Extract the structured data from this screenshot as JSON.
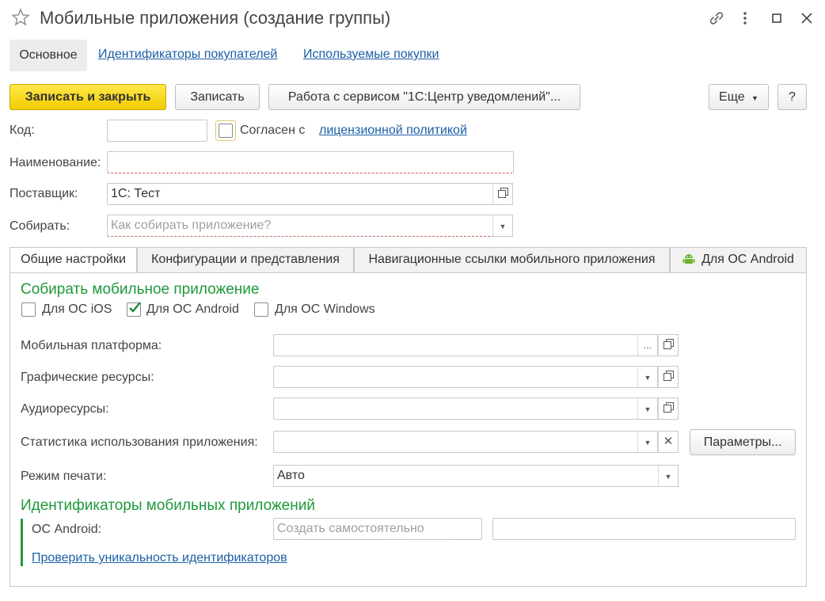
{
  "window": {
    "title": "Мобильные приложения (создание группы)"
  },
  "nav_tabs": [
    {
      "label": "Основное"
    },
    {
      "label": "Идентификаторы покупателей"
    },
    {
      "label": "Используемые покупки"
    }
  ],
  "toolbar": {
    "save_close": "Записать и закрыть",
    "save": "Записать",
    "service": "Работа с сервисом \"1С:Центр уведомлений\"...",
    "more": "Еще",
    "help": "?"
  },
  "form": {
    "code_label": "Код:",
    "code_value": "",
    "agree_text": "Согласен с",
    "license_link": "лицензионной политикой",
    "name_label": "Наименование:",
    "name_value": "",
    "supplier_label": "Поставщик:",
    "supplier_value": "1С: Тест",
    "build_label": "Собирать:",
    "build_placeholder": "Как собирать приложение?"
  },
  "content_tabs": [
    {
      "label": "Общие настройки"
    },
    {
      "label": "Конфигурации и представления"
    },
    {
      "label": "Навигационные ссылки мобильного приложения"
    },
    {
      "label": "Для ОС Android"
    }
  ],
  "general": {
    "build_section": "Собирать мобильное приложение",
    "os_ios": "Для ОС iOS",
    "os_android": "Для ОС Android",
    "os_windows": "Для ОС Windows",
    "os_ios_checked": false,
    "os_android_checked": true,
    "os_windows_checked": false,
    "platform_label": "Мобильная платформа:",
    "graphics_label": "Графические ресурсы:",
    "audio_label": "Аудиоресурсы:",
    "stats_label": "Статистика использования приложения:",
    "params_button": "Параметры...",
    "print_label": "Режим печати:",
    "print_value": "Авто",
    "ids_section": "Идентификаторы мобильных приложений",
    "android_label": "ОС Android:",
    "android_placeholder": "Создать самостоятельно",
    "check_link": "Проверить уникальность идентификаторов"
  },
  "colors": {
    "accent_yellow": "#f5d100",
    "section_green": "#1e9a3c",
    "link_blue": "#1c5fa8",
    "android_green": "#6cb62f"
  },
  "icons": [
    "star-icon",
    "link-icon",
    "more-vertical-icon",
    "maximize-icon",
    "close-icon",
    "dropdown-arrow-icon",
    "open-icon",
    "clear-icon",
    "android-icon",
    "checkmark-icon"
  ]
}
